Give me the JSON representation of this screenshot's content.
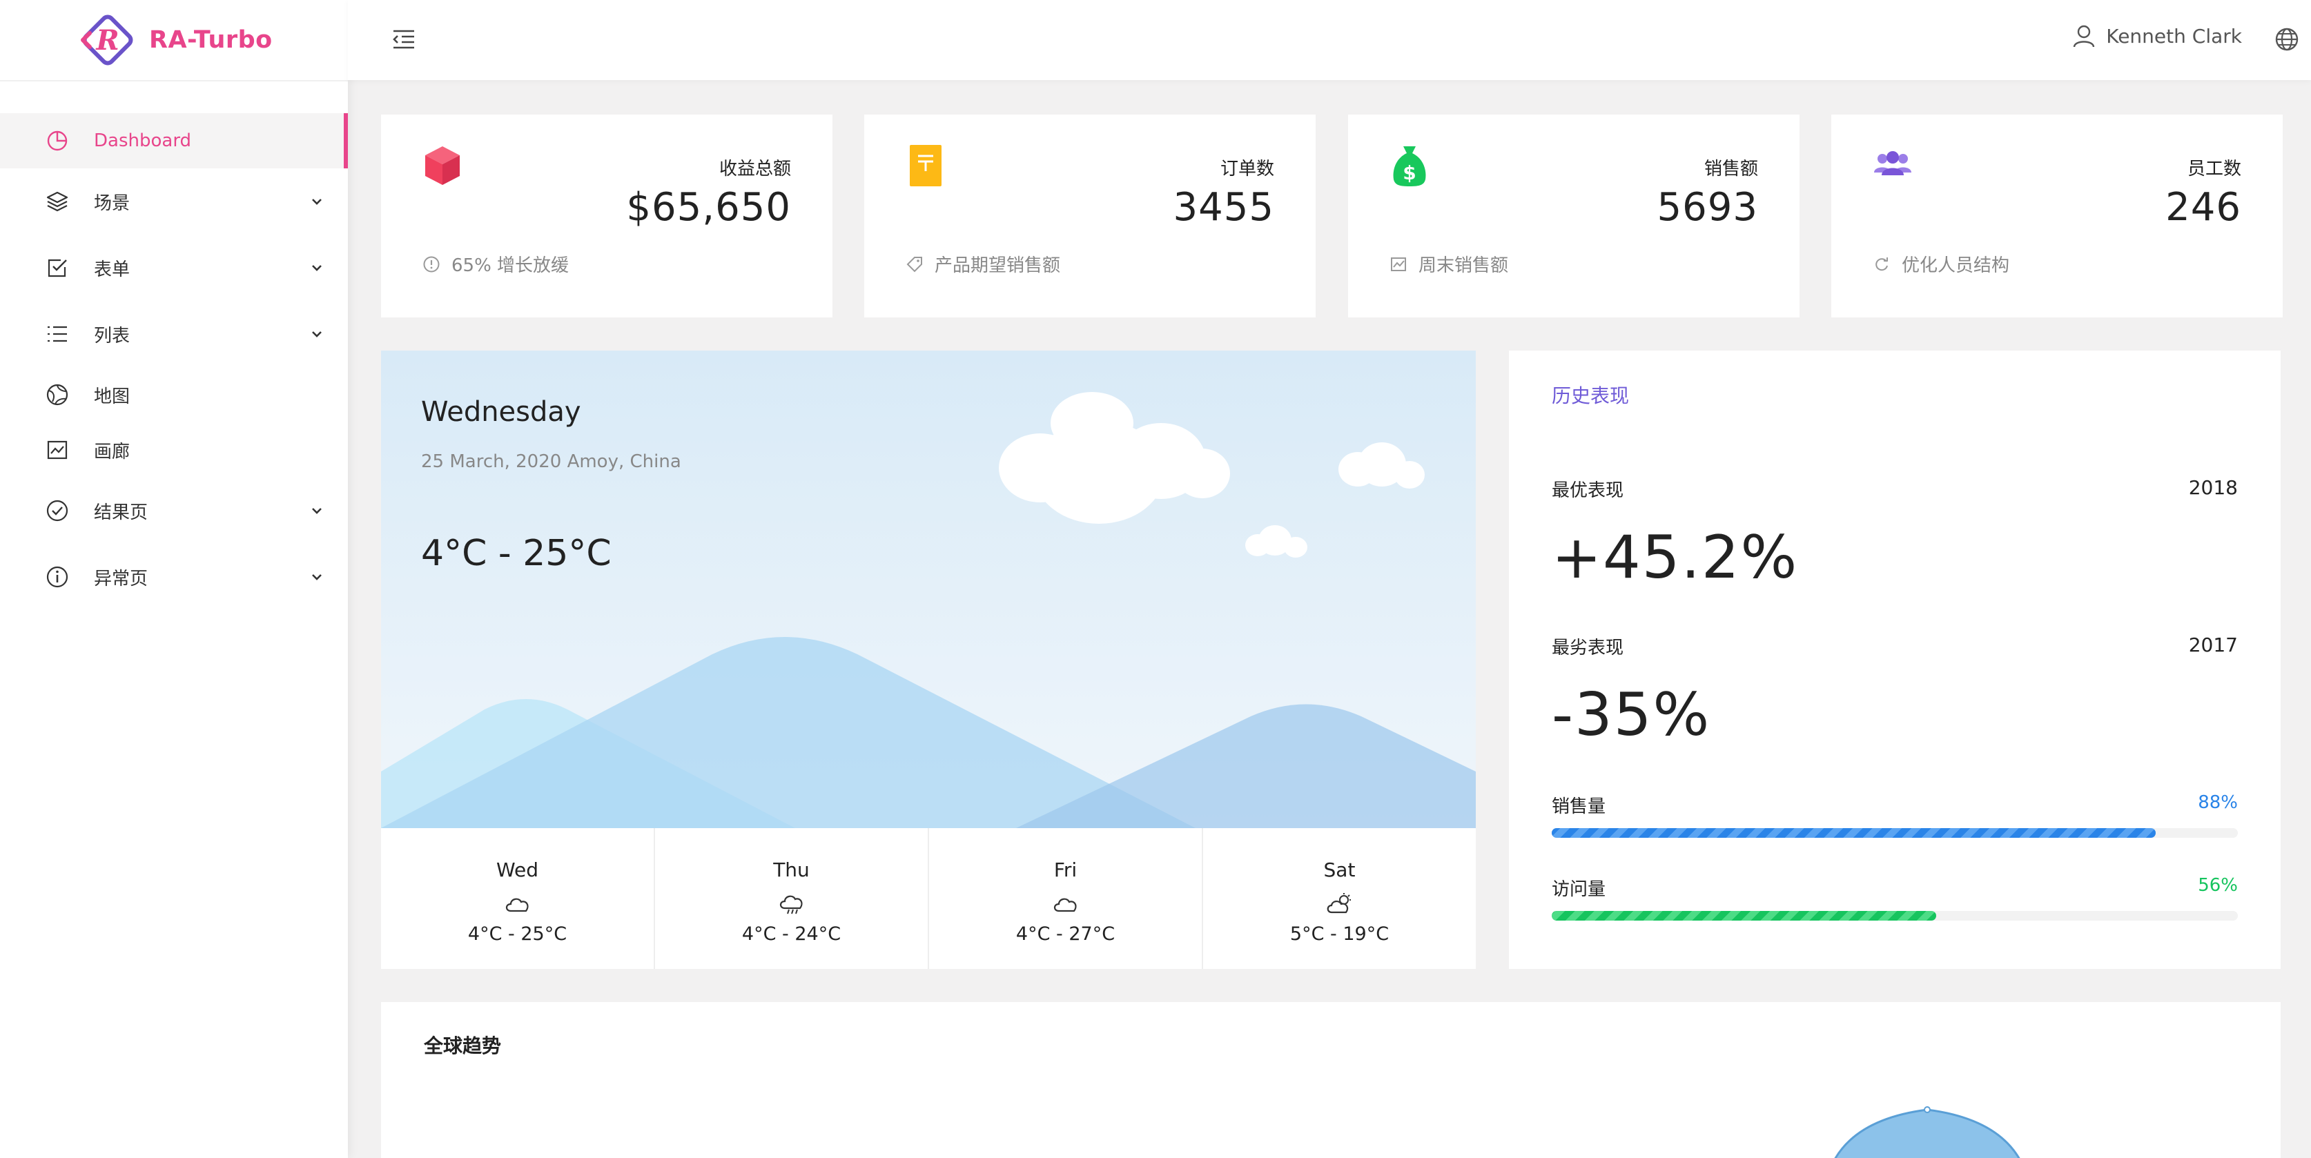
{
  "app": {
    "name": "RA-Turbo"
  },
  "sidebar": {
    "items": [
      {
        "label": "Dashboard",
        "icon": "pie-chart-icon",
        "active": true,
        "expandable": false
      },
      {
        "label": "场景",
        "icon": "layers-icon",
        "expandable": true
      },
      {
        "label": "表单",
        "icon": "checkbox-icon",
        "expandable": true
      },
      {
        "label": "列表",
        "icon": "list-icon",
        "expandable": true
      },
      {
        "label": "地图",
        "icon": "globe-map-icon",
        "expandable": false
      },
      {
        "label": "画廊",
        "icon": "gallery-icon",
        "expandable": false
      },
      {
        "label": "结果页",
        "icon": "check-circle-icon",
        "expandable": true
      },
      {
        "label": "异常页",
        "icon": "info-circle-icon",
        "expandable": true
      }
    ]
  },
  "header": {
    "user_name": "Kenneth Clark"
  },
  "stats": [
    {
      "title": "收益总额",
      "value": "$65,650",
      "footer": "65% 增长放缓",
      "icon": "box-icon",
      "color": "#f0405d"
    },
    {
      "title": "订单数",
      "value": "3455",
      "footer": "产品期望销售额",
      "icon": "receipt-icon",
      "color": "#fdb915"
    },
    {
      "title": "销售额",
      "value": "5693",
      "footer": "周末销售额",
      "icon": "money-bag-icon",
      "color": "#18c85c"
    },
    {
      "title": "员工数",
      "value": "246",
      "footer": "优化人员结构",
      "icon": "users-icon",
      "color": "#7a55d8"
    }
  ],
  "weather": {
    "day": "Wednesday",
    "date_location": "25 March, 2020 Amoy, China",
    "range": "4°C - 25°C",
    "forecast": [
      {
        "day": "Wed",
        "icon": "cloud-icon",
        "temp": "4°C - 25°C"
      },
      {
        "day": "Thu",
        "icon": "cloud-rain-icon",
        "temp": "4°C - 24°C"
      },
      {
        "day": "Fri",
        "icon": "cloud-icon",
        "temp": "4°C - 27°C"
      },
      {
        "day": "Sat",
        "icon": "cloud-sun-icon",
        "temp": "5°C - 19°C"
      }
    ]
  },
  "history": {
    "title": "历史表现",
    "best_label": "最优表现",
    "best_year": "2018",
    "best_value": "+45.2%",
    "worst_label": "最劣表现",
    "worst_year": "2017",
    "worst_value": "-35%",
    "sales_label": "销售量",
    "sales_pct": "88%",
    "sales_fraction": 0.88,
    "sales_color": "#2a84e8",
    "visits_label": "访问量",
    "visits_pct": "56%",
    "visits_fraction": 0.56,
    "visits_color": "#16c45e"
  },
  "trend": {
    "title": "全球趋势"
  },
  "colors": {
    "brand": "#e8458b",
    "accent_purple": "#6f5bd7"
  }
}
